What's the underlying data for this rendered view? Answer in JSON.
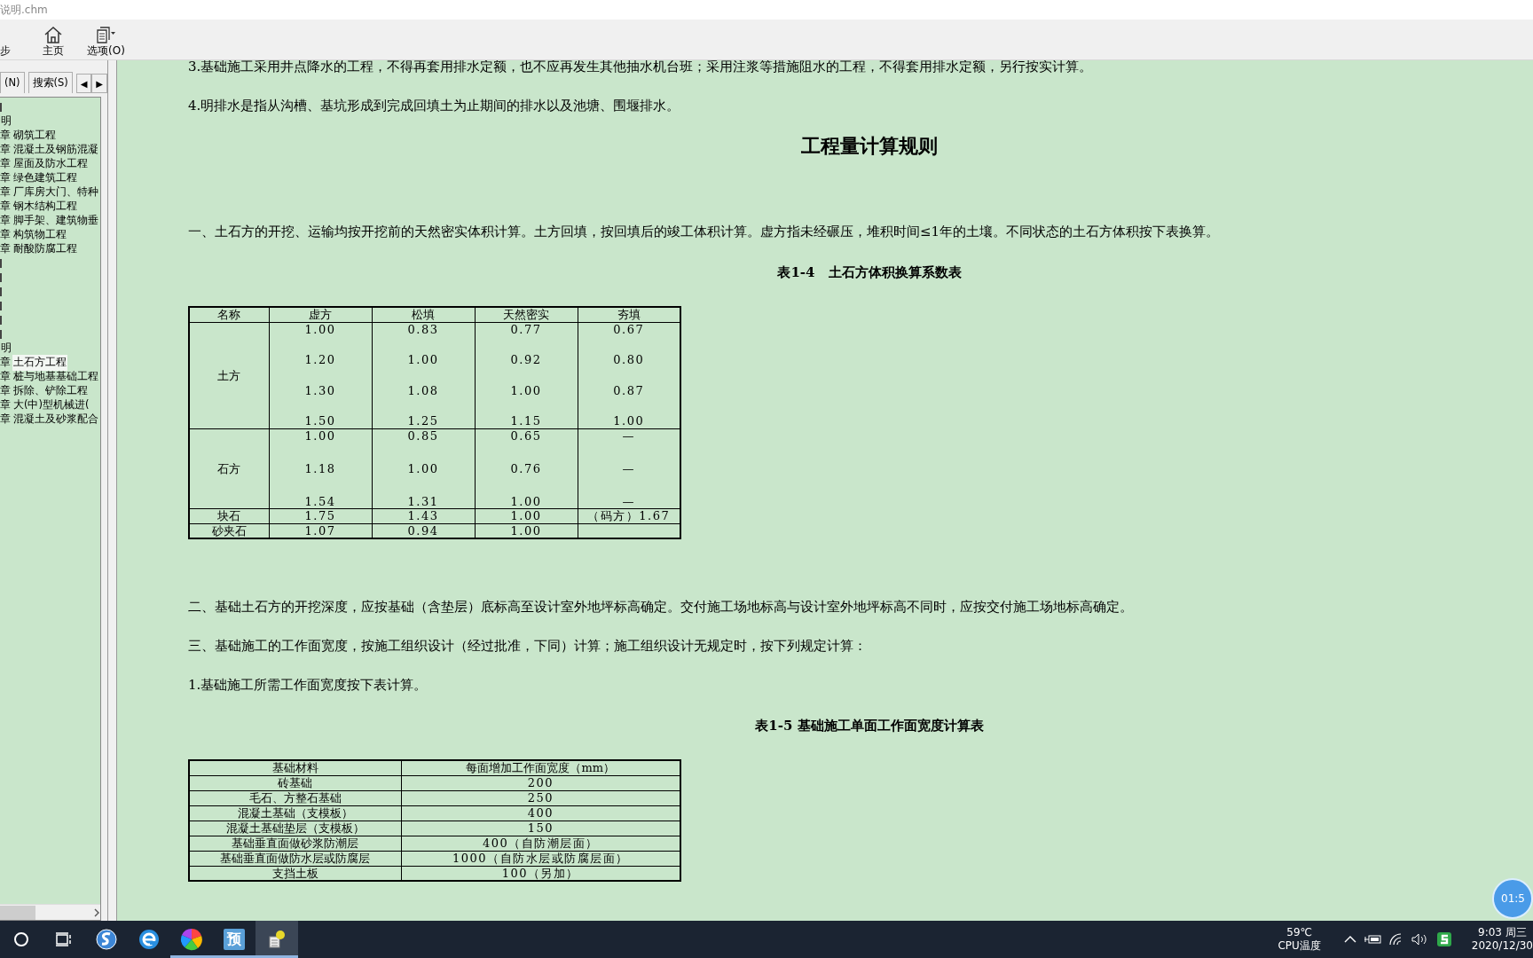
{
  "window": {
    "title": "说明.chm"
  },
  "toolbar": [
    {
      "kind": "clipped",
      "label": "步"
    },
    {
      "kind": "home",
      "label": "主页"
    },
    {
      "kind": "options",
      "label": "选项(O)"
    }
  ],
  "sidebar": {
    "tabs": [
      {
        "label": "(N)",
        "selected": false
      },
      {
        "label": "搜索(S)",
        "selected": false
      }
    ],
    "scroll_buttons": [
      "◀",
      "▶"
    ],
    "items": [
      {
        "kind": "clipped",
        "selected": false
      },
      {
        "kind": "text",
        "label": "明",
        "selected": false
      },
      {
        "kind": "chapter",
        "prefix": "章",
        "label": "砌筑工程",
        "selected": false
      },
      {
        "kind": "chapter",
        "prefix": "章",
        "label": "混凝土及钢筋混凝",
        "selected": false
      },
      {
        "kind": "chapter",
        "prefix": "章",
        "label": "屋面及防水工程",
        "selected": false
      },
      {
        "kind": "chapter",
        "prefix": "章",
        "label": "绿色建筑工程",
        "selected": false
      },
      {
        "kind": "chapter",
        "prefix": "章",
        "label": "厂库房大门、特种",
        "selected": false
      },
      {
        "kind": "chapter",
        "prefix": "章",
        "label": "钢木结构工程",
        "selected": false
      },
      {
        "kind": "chapter",
        "prefix": "章",
        "label": "脚手架、建筑物垂",
        "selected": false
      },
      {
        "kind": "chapter",
        "prefix": "章",
        "label": "构筑物工程",
        "selected": false
      },
      {
        "kind": "chapter",
        "prefix": "章",
        "label": "耐酸防腐工程",
        "selected": false
      },
      {
        "kind": "clipped",
        "selected": false
      },
      {
        "kind": "clipped",
        "selected": false
      },
      {
        "kind": "clipped",
        "selected": false
      },
      {
        "kind": "clipped",
        "selected": false
      },
      {
        "kind": "clipped",
        "selected": false
      },
      {
        "kind": "clipped",
        "selected": false
      },
      {
        "kind": "text",
        "label": "明",
        "selected": false
      },
      {
        "kind": "chapter",
        "prefix": "章",
        "label": "土石方工程",
        "selected": true
      },
      {
        "kind": "chapter",
        "prefix": "章",
        "label": "桩与地基基础工程",
        "selected": false
      },
      {
        "kind": "chapter",
        "prefix": "章",
        "label": "拆除、铲除工程",
        "selected": false
      },
      {
        "kind": "chapter",
        "prefix": "章",
        "label": "大(中)型机械进(",
        "selected": false
      },
      {
        "kind": "chapter",
        "prefix": "章",
        "label": "混凝土及砂浆配合",
        "selected": false
      }
    ]
  },
  "content": [
    {
      "kind": "para",
      "text": "3.基础施工采用井点降水的工程，不得再套用排水定额，也不应再发生其他抽水机台班；采用注浆等措施阻水的工程，不得套用排水定额，另行按实计算。"
    },
    {
      "kind": "para",
      "text": "4.明排水是指从沟槽、基坑形成到完成回填土为止期间的排水以及池塘、围堰排水。"
    },
    {
      "kind": "heading",
      "text": "工程量计算规则"
    },
    {
      "kind": "para",
      "text": "一、土石方的开挖、运输均按开挖前的天然密实体积计算。土方回填，按回填后的竣工体积计算。虚方指未经碾压，堆积时间≤1年的土壤。不同状态的土石方体积按下表换算。"
    },
    {
      "kind": "caption",
      "text": "表1-4　土石方体积换算系数表"
    },
    {
      "kind": "table",
      "columns": [
        "名称",
        "虚方",
        "松填",
        "天然密实",
        "夯填"
      ],
      "rows": [
        {
          "cells": [
            [
              "土方"
            ],
            [
              "1.00",
              "1.20",
              "1.30",
              "1.50"
            ],
            [
              "0.83",
              "1.00",
              "1.08",
              "1.25"
            ],
            [
              "0.77",
              "0.92",
              "1.00",
              "1.15"
            ],
            [
              "0.67",
              "0.80",
              "0.87",
              "1.00"
            ]
          ]
        },
        {
          "cells": [
            [
              "石方"
            ],
            [
              "1.00",
              "1.18",
              "1.54"
            ],
            [
              "0.85",
              "1.00",
              "1.31"
            ],
            [
              "0.65",
              "0.76",
              "1.00"
            ],
            [
              "—",
              "—",
              "—"
            ]
          ]
        },
        {
          "cells": [
            [
              "块石"
            ],
            [
              "1.75"
            ],
            [
              "1.43"
            ],
            [
              "1.00"
            ],
            [
              "（码方）1.67"
            ]
          ]
        },
        {
          "cells": [
            [
              "砂夹石"
            ],
            [
              "1.07"
            ],
            [
              "0.94"
            ],
            [
              "1.00"
            ],
            []
          ]
        }
      ]
    },
    {
      "kind": "para",
      "text": "二、基础土石方的开挖深度，应按基础（含垫层）底标高至设计室外地坪标高确定。交付施工场地标高与设计室外地坪标高不同时，应按交付施工场地标高确定。"
    },
    {
      "kind": "para",
      "text": "三、基础施工的工作面宽度，按施工组织设计（经过批准，下同）计算；施工组织设计无规定时，按下列规定计算："
    },
    {
      "kind": "para",
      "text": "1.基础施工所需工作面宽度按下表计算。"
    },
    {
      "kind": "caption",
      "text": "表1-5 基础施工单面工作面宽度计算表"
    },
    {
      "kind": "table",
      "columns": [
        "基础材料",
        "每面增加工作面宽度（mm）"
      ],
      "rows": [
        {
          "cells": [
            [
              "砖基础"
            ],
            [
              "200"
            ]
          ]
        },
        {
          "cells": [
            [
              "毛石、方整石基础"
            ],
            [
              "250"
            ]
          ]
        },
        {
          "cells": [
            [
              "混凝土基础（支模板）"
            ],
            [
              "400"
            ]
          ]
        },
        {
          "cells": [
            [
              "混凝土基础垫层（支模板）"
            ],
            [
              "150"
            ]
          ]
        },
        {
          "cells": [
            [
              "基础垂直面做砂浆防潮层"
            ],
            [
              "400（自防潮层面）"
            ]
          ]
        },
        {
          "cells": [
            [
              "基础垂直面做防水层或防腐层"
            ],
            [
              "1000（自防水层或防腐层面）"
            ]
          ]
        },
        {
          "cells": [
            [
              "支挡土板"
            ],
            [
              "100（另加）"
            ]
          ]
        }
      ]
    }
  ],
  "timer": "01:5",
  "taskbar": {
    "apps": [
      {
        "kind": "search",
        "running": false,
        "active": false
      },
      {
        "kind": "task-view",
        "running": false,
        "active": false
      },
      {
        "kind": "sogou",
        "running": false,
        "active": false
      },
      {
        "kind": "ie",
        "running": false,
        "active": false
      },
      {
        "kind": "pinwheel",
        "running": true,
        "active": false
      },
      {
        "kind": "preview",
        "label": "预",
        "running": true,
        "active": false
      },
      {
        "kind": "help",
        "running": true,
        "active": true
      }
    ],
    "temperature": "59℃",
    "temperature_label": "CPU温度",
    "time": "9:03 周三",
    "date": "2020/12/30"
  }
}
